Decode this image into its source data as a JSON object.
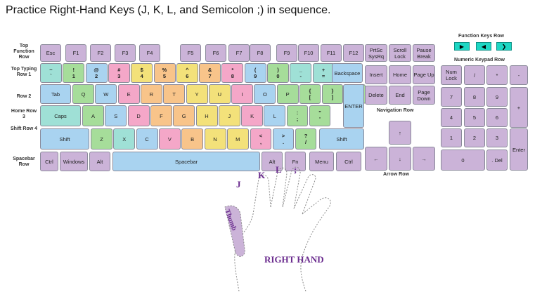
{
  "title": "Practice Right-Hand Keys (J, K, L, and Semicolon ;) in sequence.",
  "row_labels": {
    "function": "Top Function Row",
    "typing": "Top Typing Row 1",
    "row2": "Row 2",
    "home": "Home Row 3",
    "shift": "Shift Row 4",
    "spacebar": "Spacebar Row"
  },
  "function_keys_label": "Function Keys Row",
  "numeric_keypad_label": "Numeric Keypad Row",
  "navigation_label": "Navigation Row",
  "arrow_label": "Arrow Row",
  "fn_row": [
    "Esc",
    "F1",
    "F2",
    "F3",
    "F4",
    "F5",
    "F6",
    "F7",
    "F8",
    "F9",
    "F10",
    "F11",
    "F12"
  ],
  "sys_keys": [
    "PrtSc SysRq",
    "Scroll Lock",
    "Pause Break"
  ],
  "media_buttons": [
    "▶",
    "◀",
    "❯"
  ],
  "typing_row": [
    {
      "top": "~",
      "bot": "`"
    },
    {
      "top": "!",
      "bot": "1"
    },
    {
      "top": "@",
      "bot": "2"
    },
    {
      "top": "#",
      "bot": "3"
    },
    {
      "top": "$",
      "bot": "4"
    },
    {
      "top": "%",
      "bot": "5"
    },
    {
      "top": "^",
      "bot": "6"
    },
    {
      "top": "&",
      "bot": "7"
    },
    {
      "top": "*",
      "bot": "8"
    },
    {
      "top": "(",
      "bot": "9"
    },
    {
      "top": ")",
      "bot": "0"
    },
    {
      "top": "_",
      "bot": "-"
    },
    {
      "top": "+",
      "bot": "="
    }
  ],
  "backspace": "Backspace",
  "row2_keys": [
    "Tab",
    "Q",
    "W",
    "E",
    "R",
    "T",
    "Y",
    "U",
    "I",
    "O",
    "P"
  ],
  "row2_brackets": [
    {
      "top": "{",
      "bot": "["
    },
    {
      "top": "}",
      "bot": "]"
    },
    {
      "top": "|",
      "bot": "\\"
    }
  ],
  "enter": "ENTER",
  "home_keys": [
    "Caps",
    "A",
    "S",
    "D",
    "F",
    "G",
    "H",
    "J",
    "K",
    "L"
  ],
  "home_punct": [
    {
      "top": ":",
      "bot": ";"
    },
    {
      "top": "\"",
      "bot": "'"
    }
  ],
  "shift_keys": [
    "Shift",
    "Z",
    "X",
    "C",
    "V",
    "B",
    "N",
    "M"
  ],
  "shift_punct": [
    {
      "top": "<",
      "bot": ","
    },
    {
      "top": ">",
      "bot": "."
    },
    {
      "top": "?",
      "bot": "/"
    }
  ],
  "right_shift": "Shift",
  "space_row": [
    "Ctrl",
    "Windows",
    "Alt",
    "Spacebar",
    "Alt",
    "Fn",
    "Menu",
    "Ctrl"
  ],
  "nav_keys": [
    "Insert",
    "Home",
    "Page Up",
    "Delete",
    "End",
    "Page Down"
  ],
  "arrows": [
    "↑",
    "←",
    "↓",
    "→"
  ],
  "numpad": [
    "Num Lock",
    "/",
    "*",
    "-",
    "7",
    "8",
    "9",
    "+",
    "4",
    "5",
    "6",
    "1",
    "2",
    "3",
    "Enter",
    "0",
    ". Del"
  ],
  "hand": {
    "fingers": [
      "J",
      "K",
      "L",
      ";"
    ],
    "thumb": "Thumb",
    "label": "RIGHT HAND"
  }
}
